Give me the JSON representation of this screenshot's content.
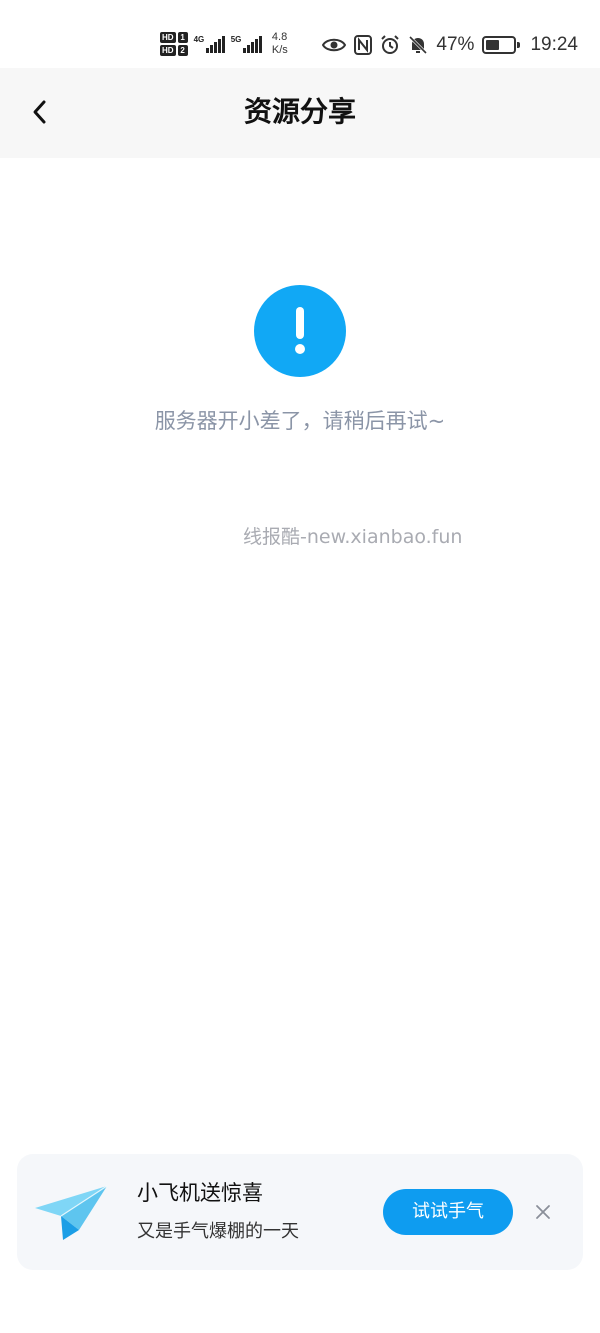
{
  "status_bar": {
    "hd1": "HD",
    "sim1": "1",
    "hd2": "HD",
    "sim2": "2",
    "net1": "4G",
    "net2": "5G",
    "speed_value": "4.8",
    "speed_unit": "K/s",
    "battery_percent": "47%",
    "battery_level": 0.47,
    "time": "19:24",
    "icons": [
      "eye-icon",
      "nfc-icon",
      "alarm-icon",
      "mute-bell-icon",
      "battery-icon"
    ]
  },
  "header": {
    "title": "资源分享",
    "back_icon": "chevron-left-icon"
  },
  "error": {
    "icon": "exclamation-circle-icon",
    "icon_color": "#11a8f5",
    "message": "服务器开小差了，请稍后再试~"
  },
  "watermark": "线报酷-new.xianbao.fun",
  "promo": {
    "icon": "paper-plane-icon",
    "title": "小飞机送惊喜",
    "subtitle": "又是手气爆棚的一天",
    "button_label": "试试手气",
    "button_color": "#0e9cf0",
    "close_icon": "close-icon"
  }
}
